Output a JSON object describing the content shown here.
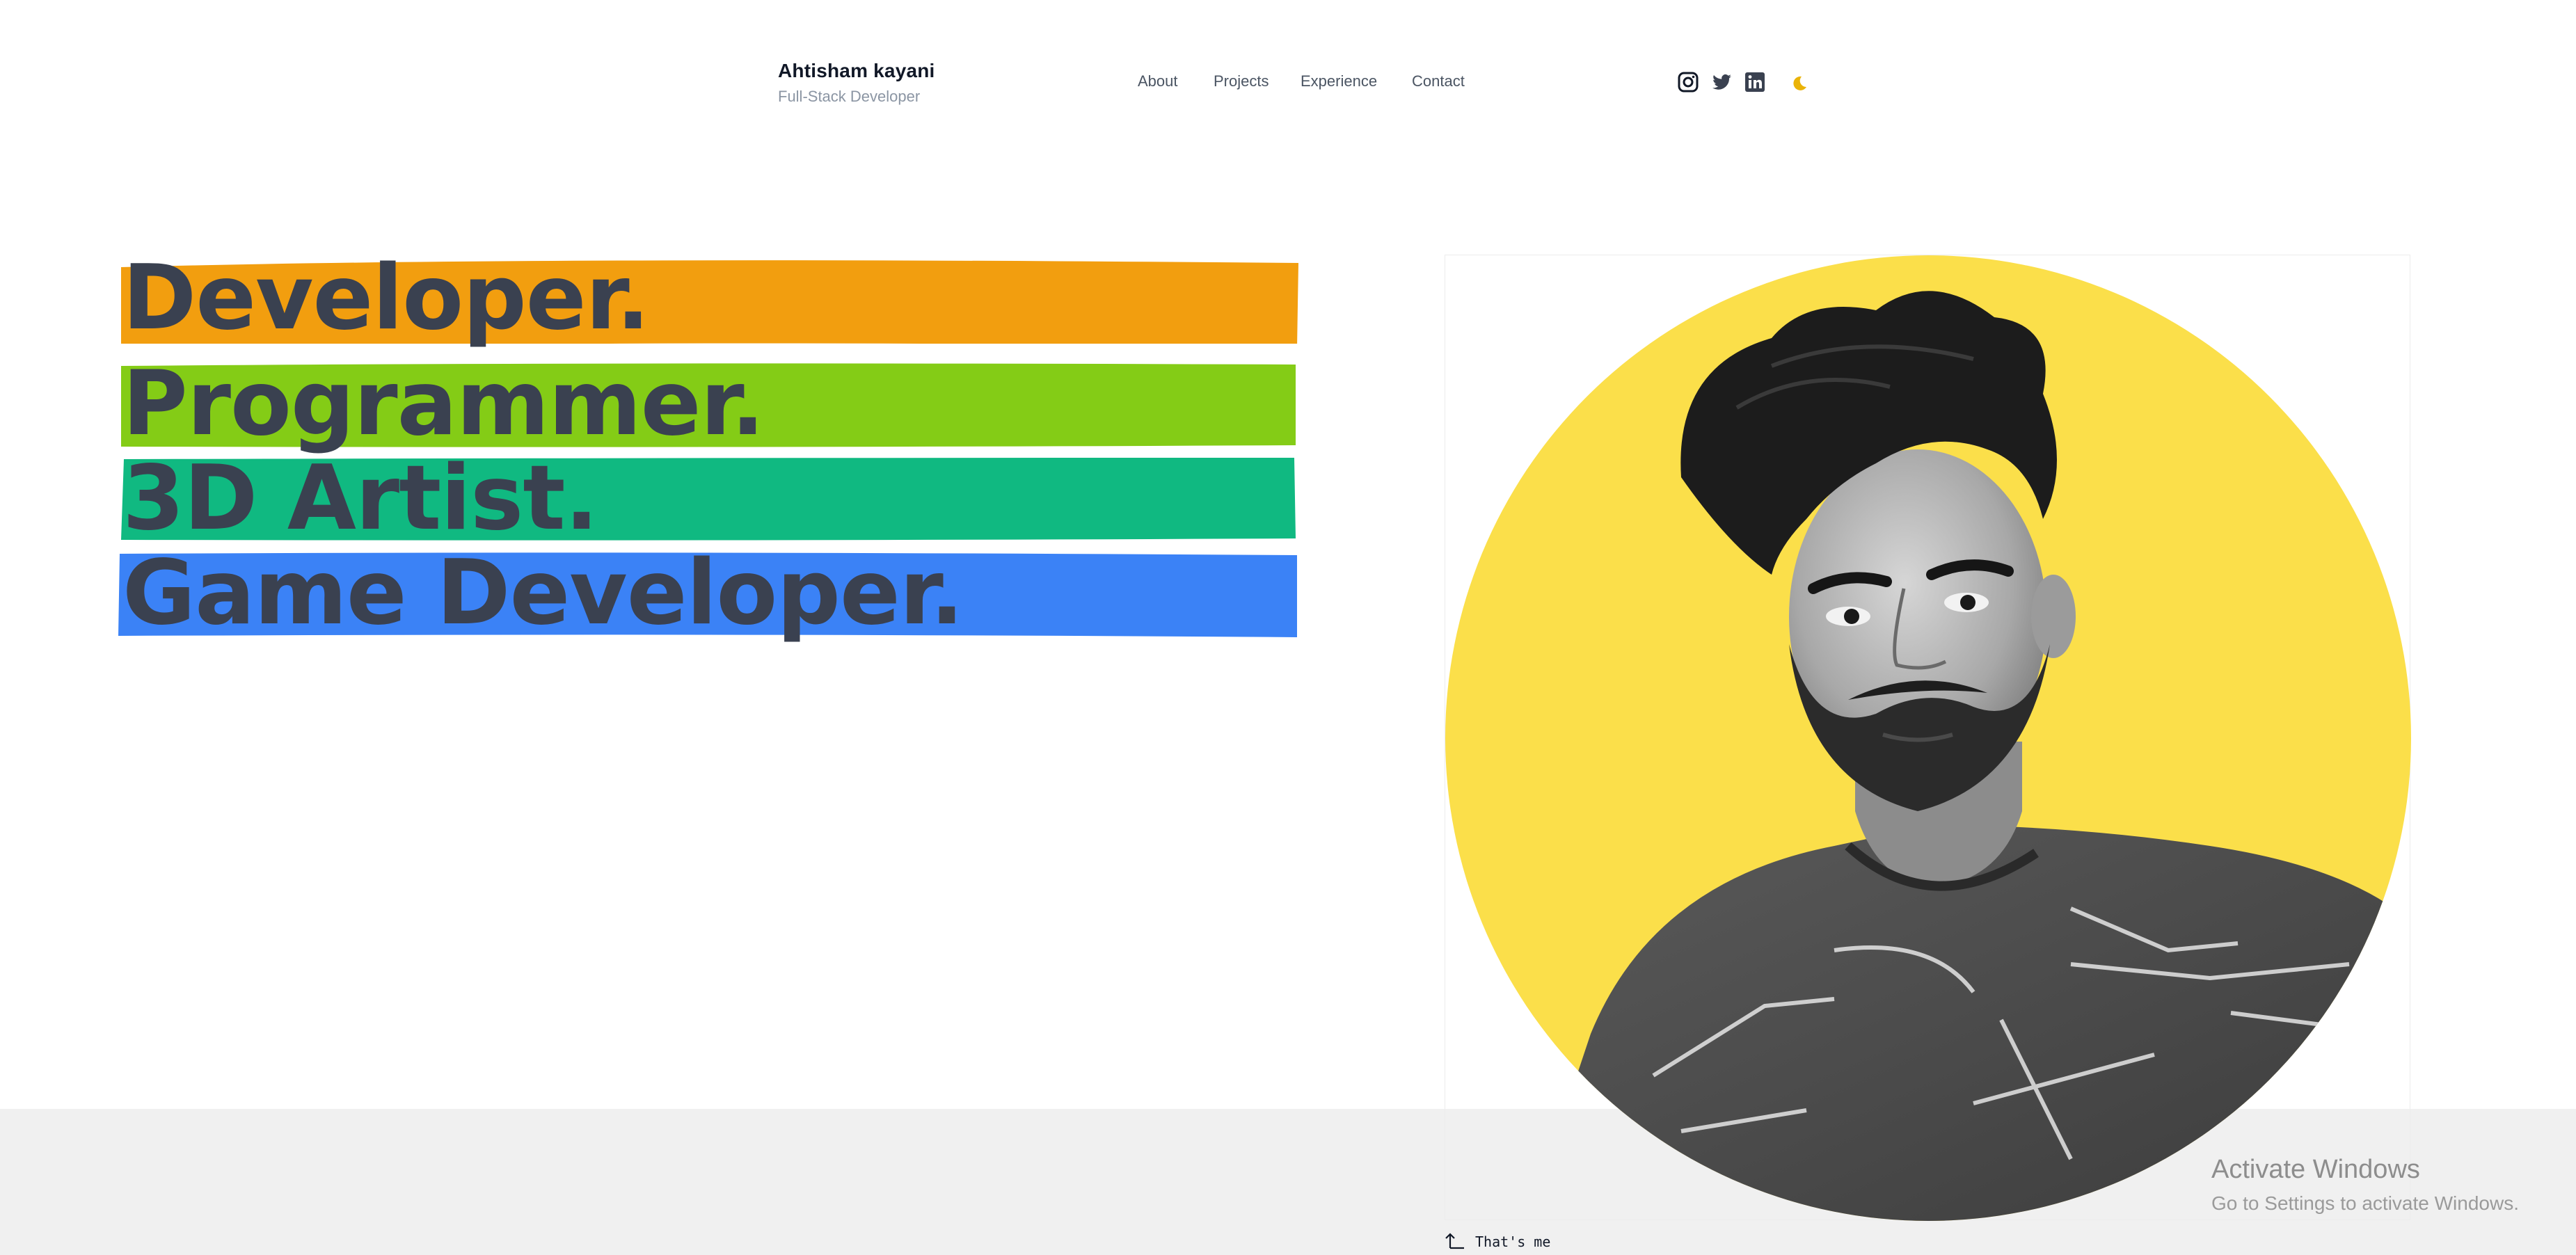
{
  "header": {
    "name": "Ahtisham kayani",
    "role": "Full-Stack Developer",
    "nav": [
      "About",
      "Projects",
      "Experience",
      "Contact"
    ],
    "socials": [
      "instagram-icon",
      "twitter-icon",
      "linkedin-icon"
    ],
    "theme_toggle_icon": "moon-icon"
  },
  "hero": {
    "headings": [
      {
        "text": "Developer.",
        "color": "#f29e0f"
      },
      {
        "text": "Programmer.",
        "color": "#84cc16"
      },
      {
        "text": "3D Artist.",
        "color": "#10b981"
      },
      {
        "text": "Game Developer.",
        "color": "#3b82f6"
      }
    ],
    "portrait_bg": "#fbdf4a",
    "caption": "That's me"
  },
  "watermark": {
    "title": "Activate Windows",
    "subtitle": "Go to Settings to activate Windows."
  }
}
